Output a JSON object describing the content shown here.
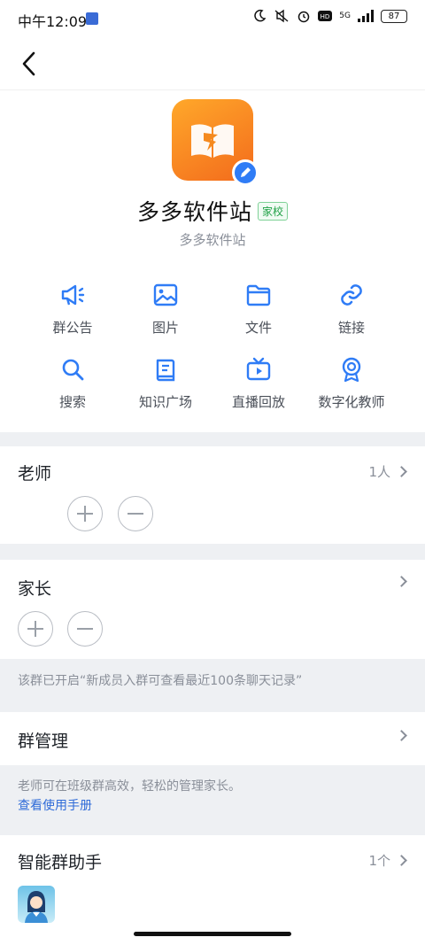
{
  "status_bar": {
    "time": "中午12:09",
    "network": "5G",
    "battery": "87"
  },
  "group": {
    "name": "多多软件站",
    "tag": "家校",
    "subtitle": "多多软件站"
  },
  "actions": [
    {
      "label": "群公告",
      "icon": "megaphone-icon"
    },
    {
      "label": "图片",
      "icon": "image-icon"
    },
    {
      "label": "文件",
      "icon": "folder-icon"
    },
    {
      "label": "链接",
      "icon": "link-icon"
    },
    {
      "label": "搜索",
      "icon": "search-icon"
    },
    {
      "label": "知识广场",
      "icon": "book-icon"
    },
    {
      "label": "直播回放",
      "icon": "tv-play-icon"
    },
    {
      "label": "数字化教师",
      "icon": "badge-icon"
    }
  ],
  "teachers": {
    "title": "老师",
    "count": "1人"
  },
  "parents": {
    "title": "家长"
  },
  "history_note": "该群已开启“新成员入群可查看最近100条聊天记录”",
  "management": {
    "title": "群管理",
    "note": "老师可在班级群高效，轻松的管理家长。",
    "manual_link": "查看使用手册"
  },
  "assistant": {
    "title": "智能群助手",
    "count": "1个"
  },
  "colors": {
    "accent": "#2f7cf6",
    "tag_green": "#21a147",
    "logo_orange": "#f58a1f"
  }
}
